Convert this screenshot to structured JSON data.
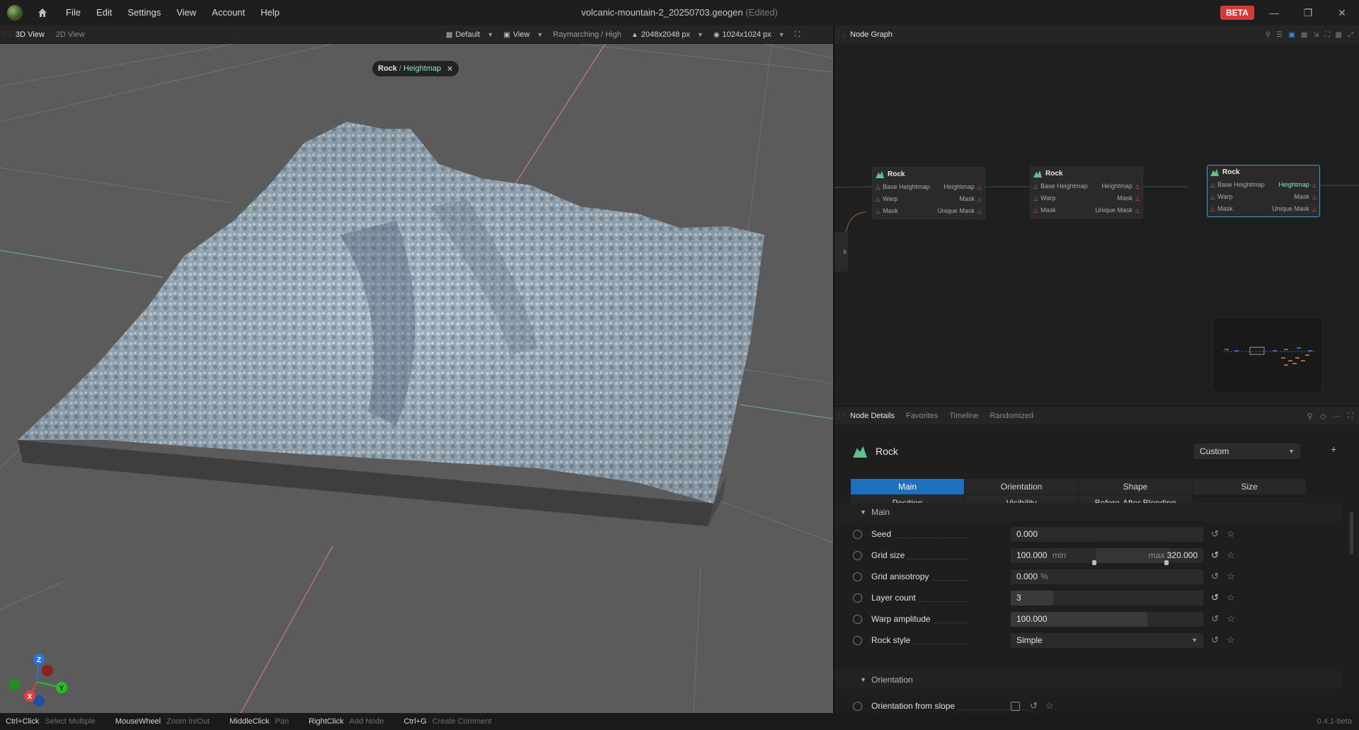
{
  "app": {
    "menu": [
      "File",
      "Edit",
      "Settings",
      "View",
      "Account",
      "Help"
    ],
    "doc_title": "volcanic-mountain-2_20250703.geogen",
    "doc_status": "(Edited)",
    "beta": "BETA"
  },
  "view_panel": {
    "tabs": [
      "3D View",
      "2D View"
    ],
    "tools": {
      "preset": "Default",
      "view": "View",
      "render_mode": "Raymarching / High",
      "resolution": "2048x2048 px",
      "preview_resolution": "1024x1024 px"
    },
    "breadcrumb": {
      "node": "Rock",
      "separator": "/",
      "output": "Heightmap"
    },
    "gizmo": {
      "x": "X",
      "y": "Y",
      "z": "Z"
    }
  },
  "graph_panel": {
    "title": "Node Graph",
    "nodes": [
      {
        "title": "Rock",
        "inputs": [
          "Base Heightmap",
          "Warp",
          "Mask"
        ],
        "outputs": [
          "Heightmap",
          "Mask",
          "Unique Mask"
        ]
      },
      {
        "title": "Rock",
        "inputs": [
          "Base Heightmap",
          "Warp",
          "Mask"
        ],
        "outputs": [
          "Heightmap",
          "Mask",
          "Unique Mask"
        ]
      },
      {
        "title": "Rock",
        "inputs": [
          "Base Heightmap",
          "Warp",
          "Mask"
        ],
        "outputs": [
          "Heightmap",
          "Mask",
          "Unique Mask"
        ]
      }
    ],
    "partial_node_label": "k"
  },
  "details_panel": {
    "tabs": [
      "Node Details",
      "Favorites",
      "Timeline",
      "Randomized"
    ],
    "node_name": "Rock",
    "preset": "Custom",
    "subtabs": [
      "Main",
      "Orientation",
      "Shape",
      "Size",
      "Position",
      "Visibility",
      "Before-After Blending"
    ],
    "sections": {
      "main": "Main",
      "orientation": "Orientation"
    },
    "params": {
      "seed": {
        "label": "Seed",
        "value": "0.000"
      },
      "grid_size": {
        "label": "Grid size",
        "min_value": "100.000",
        "min_label": "min",
        "max_label": "max",
        "max_value": "320.000"
      },
      "grid_anisotropy": {
        "label": "Grid anisotropy",
        "value": "0.000",
        "unit": "%"
      },
      "layer_count": {
        "label": "Layer count",
        "value": "3",
        "fill": 0.22
      },
      "warp_amplitude": {
        "label": "Warp amplitude",
        "value": "100.000",
        "unit": "%",
        "fill": 0.71
      },
      "rock_style": {
        "label": "Rock style",
        "value": "Simple"
      },
      "orientation_from_slope": {
        "label": "Orientation from slope",
        "checked": false
      }
    }
  },
  "statusbar": {
    "hints": [
      {
        "key": "Ctrl+Click",
        "action": "Select Multiple"
      },
      {
        "key": "MouseWheel",
        "action": "Zoom In/Out"
      },
      {
        "key": "MiddleClick",
        "action": "Pan"
      },
      {
        "key": "RightClick",
        "action": "Add Node"
      },
      {
        "key": "Ctrl+G",
        "action": "Create Comment"
      }
    ],
    "version": "0.4.1-beta"
  },
  "colors": {
    "accent": "#1f6fbf",
    "beta_badge": "#d23a3a",
    "heightmap_port": "#8fe3c5",
    "node_icon": "#5fc08c"
  },
  "icons": [
    "app-logo-icon",
    "home-icon",
    "minimize-icon",
    "maximize-icon",
    "close-icon",
    "search-icon",
    "reset-icon",
    "star-icon",
    "chevron-down-icon",
    "plus-icon"
  ]
}
